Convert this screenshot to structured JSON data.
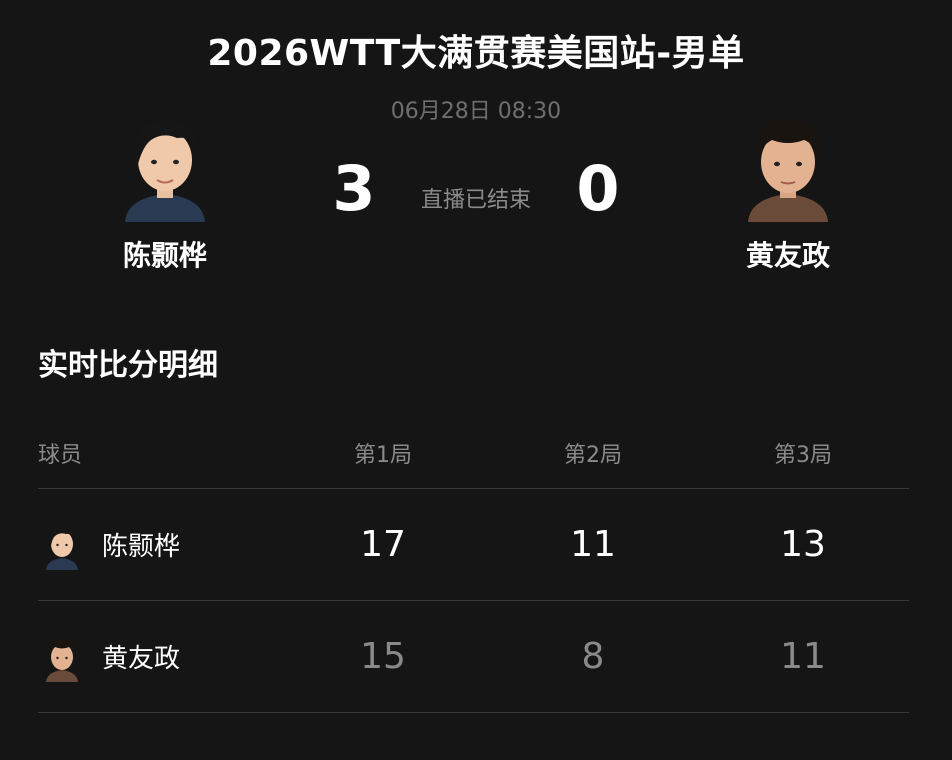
{
  "match": {
    "title": "2026WTT大满贯赛美国站-男单",
    "datetime": "06月28日 08:30",
    "status": "直播已结束"
  },
  "players": {
    "left": {
      "name": "陈颢桦",
      "score": "3"
    },
    "right": {
      "name": "黄友政",
      "score": "0"
    }
  },
  "breakdown": {
    "section_title": "实时比分明细",
    "headers": {
      "player": "球员",
      "game1": "第1局",
      "game2": "第2局",
      "game3": "第3局"
    },
    "rows": [
      {
        "name": "陈颢桦",
        "g1": "17",
        "g2": "11",
        "g3": "13"
      },
      {
        "name": "黄友政",
        "g1": "15",
        "g2": "8",
        "g3": "11"
      }
    ]
  },
  "colors": {
    "background": "#151515",
    "primary_text": "#ffffff",
    "secondary_text": "#8a8a8a",
    "divider": "#3a3a3a"
  }
}
